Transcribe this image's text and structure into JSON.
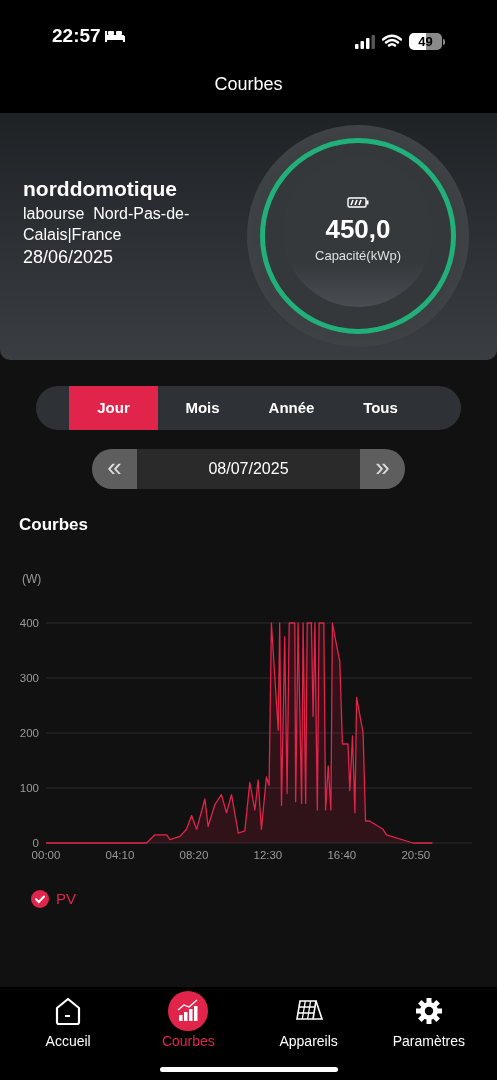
{
  "status_bar": {
    "time": "22:57",
    "battery": "49"
  },
  "header": {
    "title": "Courbes"
  },
  "site": {
    "name": "norddomotique",
    "location": "labourse  Nord-Pas-de-Calais|France",
    "date": "28/06/2025",
    "capacity": "450,0",
    "capacity_label": "Capacité(kWp)"
  },
  "periods": [
    {
      "label": "Jour",
      "selected": true
    },
    {
      "label": "Mois",
      "selected": false
    },
    {
      "label": "Année",
      "selected": false
    },
    {
      "label": "Tous",
      "selected": false
    }
  ],
  "date_pager": {
    "prev": "«",
    "date": "08/07/2025",
    "next": "»"
  },
  "section_title": "Courbes",
  "chart_data": {
    "type": "line",
    "ylabel": "(W)",
    "x": [
      0,
      340,
      368,
      408,
      419,
      453,
      475,
      492,
      509,
      537,
      548,
      571,
      593,
      610,
      627,
      650,
      672,
      689,
      706,
      717,
      728,
      745,
      754,
      762,
      785,
      790,
      796,
      807,
      815,
      822,
      841,
      844,
      852,
      864,
      869,
      878,
      883,
      897,
      903,
      909,
      917,
      923,
      939,
      945,
      954,
      963,
      968,
      982,
      993,
      1002,
      1021,
      1027,
      1036,
      1044,
      1050,
      1072,
      1080,
      1094,
      1139,
      1151,
      1241,
      1306
    ],
    "series": [
      {
        "name": "PV",
        "color": "#e0244a",
        "values": [
          0,
          0,
          15,
          15,
          6,
          12,
          25,
          50,
          25,
          80,
          30,
          70,
          88,
          55,
          88,
          18,
          22,
          110,
          60,
          115,
          25,
          120,
          105,
          400,
          205,
          400,
          68,
          375,
          90,
          400,
          400,
          75,
          400,
          72,
          400,
          72,
          400,
          400,
          230,
          400,
          60,
          400,
          400,
          60,
          140,
          60,
          400,
          360,
          330,
          180,
          180,
          95,
          195,
          55,
          265,
          200,
          40,
          40,
          25,
          15,
          0,
          0
        ]
      }
    ],
    "xlim": [
      0,
      1440
    ],
    "ylim": [
      0,
      400
    ],
    "xticks": [
      {
        "value": 0,
        "label": "00:00"
      },
      {
        "value": 250,
        "label": "04:10"
      },
      {
        "value": 500,
        "label": "08:20"
      },
      {
        "value": 750,
        "label": "12:30"
      },
      {
        "value": 1000,
        "label": "16:40"
      },
      {
        "value": 1250,
        "label": "20:50"
      }
    ],
    "yticks": [
      0,
      100,
      200,
      300,
      400
    ],
    "grid": true
  },
  "legend": [
    {
      "checked": true
    }
  ],
  "nav": [
    {
      "label": "Accueil",
      "kind": "home",
      "selected": false
    },
    {
      "label": "Courbes",
      "kind": "chart",
      "selected": true
    },
    {
      "label": "Appareils",
      "kind": "panel",
      "selected": false
    },
    {
      "label": "Paramètres",
      "kind": "gear",
      "selected": false
    }
  ]
}
